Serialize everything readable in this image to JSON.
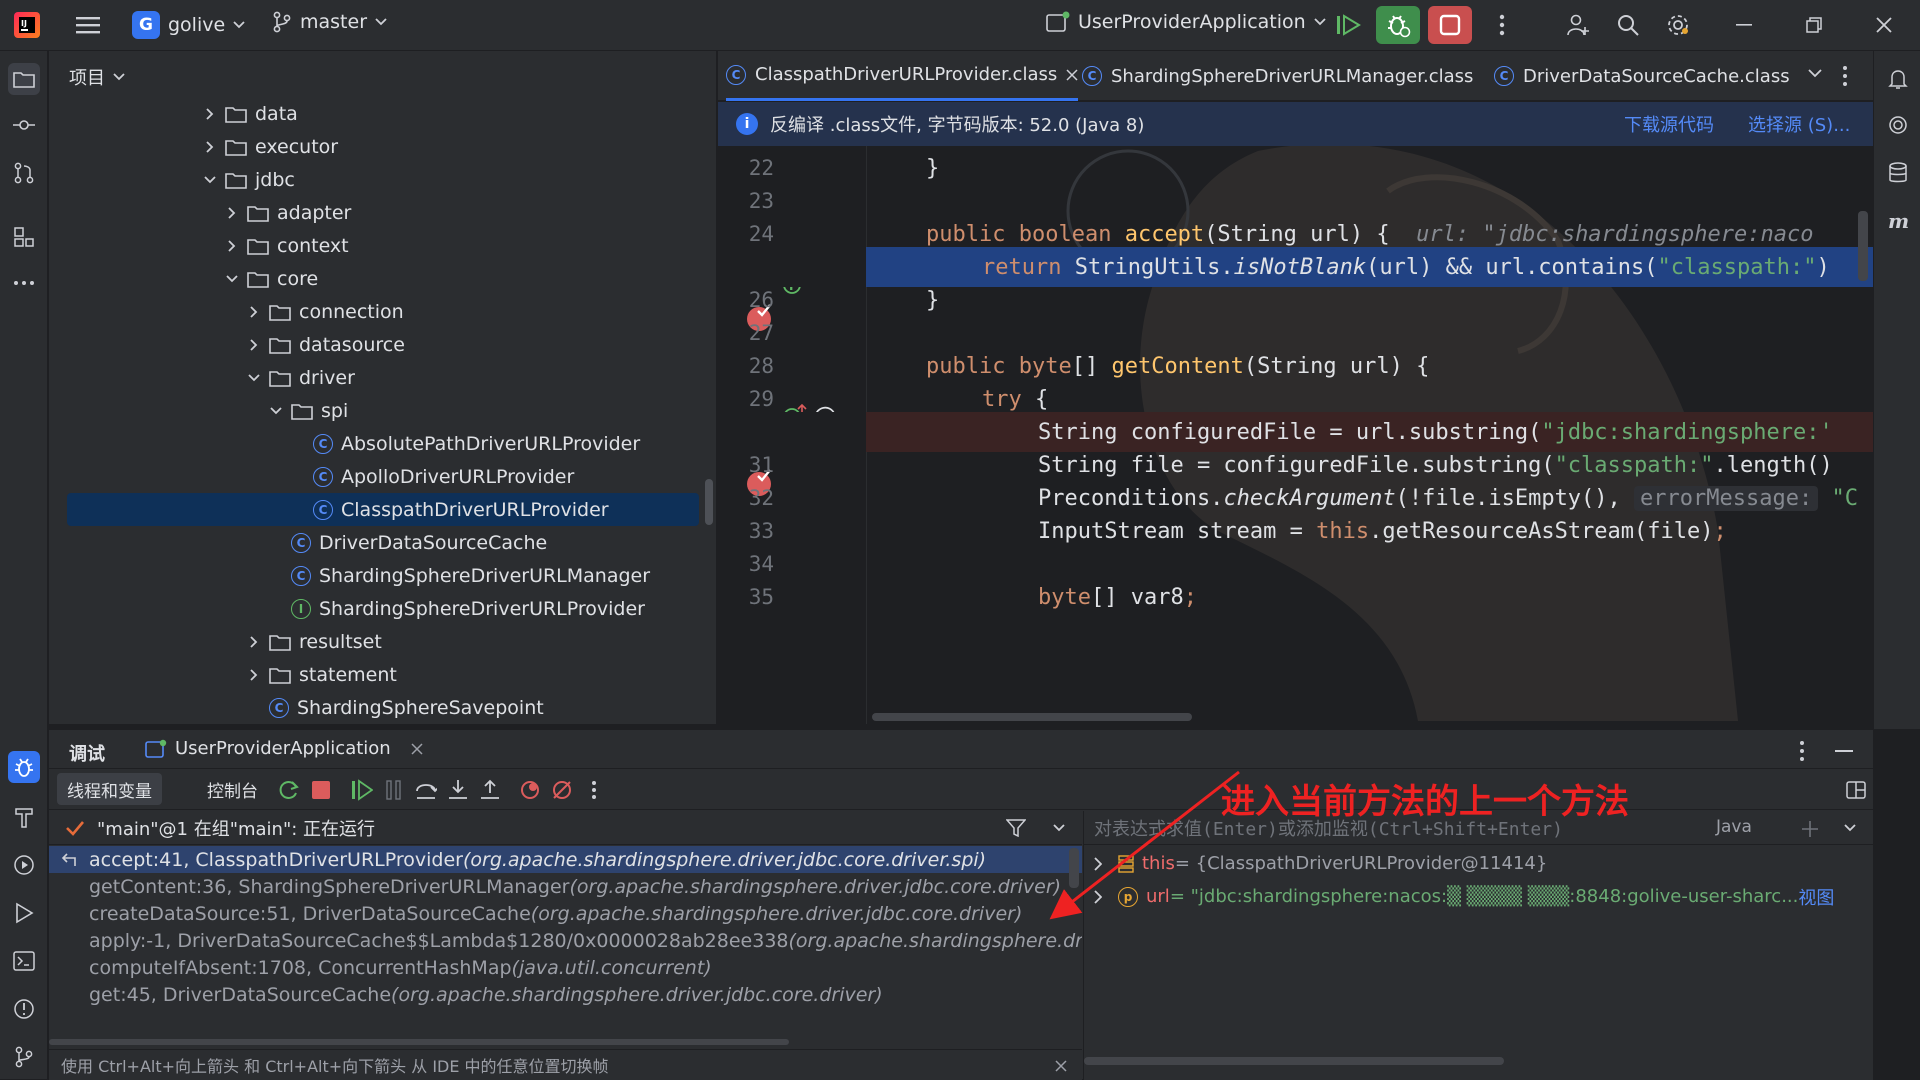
{
  "titlebar": {
    "project_badge": "G",
    "project_name": "golive",
    "branch": "master",
    "run_config": "UserProviderApplication"
  },
  "project_panel": {
    "title": "项目",
    "tree": [
      {
        "label": "data",
        "kind": "folder",
        "open": false,
        "depth": 0
      },
      {
        "label": "executor",
        "kind": "folder",
        "open": false,
        "depth": 0
      },
      {
        "label": "jdbc",
        "kind": "folder",
        "open": true,
        "depth": 0
      },
      {
        "label": "adapter",
        "kind": "folder",
        "open": false,
        "depth": 1
      },
      {
        "label": "context",
        "kind": "folder",
        "open": false,
        "depth": 1
      },
      {
        "label": "core",
        "kind": "folder",
        "open": true,
        "depth": 1
      },
      {
        "label": "connection",
        "kind": "folder",
        "open": false,
        "depth": 2
      },
      {
        "label": "datasource",
        "kind": "folder",
        "open": false,
        "depth": 2
      },
      {
        "label": "driver",
        "kind": "folder",
        "open": true,
        "depth": 2
      },
      {
        "label": "spi",
        "kind": "folder",
        "open": true,
        "depth": 3
      },
      {
        "label": "AbsolutePathDriverURLProvider",
        "kind": "class",
        "depth": 4
      },
      {
        "label": "ApolloDriverURLProvider",
        "kind": "class",
        "depth": 4
      },
      {
        "label": "ClasspathDriverURLProvider",
        "kind": "class",
        "depth": 4,
        "selected": true
      },
      {
        "label": "DriverDataSourceCache",
        "kind": "class",
        "depth": 3
      },
      {
        "label": "ShardingSphereDriverURLManager",
        "kind": "class",
        "depth": 3
      },
      {
        "label": "ShardingSphereDriverURLProvider",
        "kind": "interface",
        "depth": 3
      },
      {
        "label": "resultset",
        "kind": "folder",
        "open": false,
        "depth": 2
      },
      {
        "label": "statement",
        "kind": "folder",
        "open": false,
        "depth": 2
      },
      {
        "label": "ShardingSphereSavepoint",
        "kind": "class",
        "depth": 2
      }
    ]
  },
  "editor": {
    "tabs": [
      {
        "label": "ClasspathDriverURLProvider.class",
        "active": true
      },
      {
        "label": "ShardingSphereDriverURLManager.class",
        "active": false
      },
      {
        "label": "DriverDataSourceCache.class",
        "active": false
      }
    ],
    "infobar": {
      "text": "反编译 .class文件, 字节码版本: 52.0 (Java 8)",
      "download_link": "下载源代码",
      "choose_link": "选择源 (S)..."
    },
    "line_numbers": [
      "22",
      "23",
      "24",
      "",
      "26",
      "27",
      "28",
      "29",
      "",
      "31",
      "32",
      "33",
      "34",
      "35"
    ],
    "code": {
      "l22": "}",
      "l24_kw1": "public",
      "l24_kw2": "boolean",
      "l24_fn": "accept",
      "l24_rest": "(String url) {",
      "l24_hint": "url: \"jdbc:shardingsphere:naco",
      "l25_kw": "return",
      "l25_a": " StringUtils.",
      "l25_fn": "isNotBlank",
      "l25_b": "(url) && url.contains(",
      "l25_str": "\"classpath:\"",
      "l25_c": ")",
      "l26": "}",
      "l28_kw1": "public",
      "l28_kw2": "byte",
      "l28_a": "[] ",
      "l28_fn": "getContent",
      "l28_rest": "(String url) {",
      "l29_kw": "try",
      "l29_rest": " {",
      "l30_a": "String configuredFile = url.substring(",
      "l30_str": "\"jdbc:shardingsphere:'",
      "l31_a": "String file = configuredFile.substring(",
      "l31_str": "\"classpath:\"",
      "l31_b": ".length()",
      "l32_a": "Preconditions.",
      "l32_fn": "checkArgument",
      "l32_b": "(!file.isEmpty(),",
      "l32_hint": "errorMessage:",
      "l32_str": "\"C",
      "l33_a": "InputStream stream = ",
      "l33_kw": "this",
      "l33_b": ".getResourceAsStream(file)",
      "l33_semi": ";",
      "l35_kw": "byte",
      "l35_a": "[] var8",
      "l35_semi": ";"
    }
  },
  "debug": {
    "tab_debug": "调试",
    "tab_session": "UserProviderApplication",
    "subtab_threads": "线程和变量",
    "subtab_console": "控制台",
    "thread_status": "\"main\"@1 在组\"main\": 正在运行",
    "frames": [
      {
        "loc": "accept:41, ClasspathDriverURLProvider ",
        "pkg": "(org.apache.shardingsphere.driver.jdbc.core.driver.spi)",
        "selected": true
      },
      {
        "loc": "getContent:36, ShardingSphereDriverURLManager ",
        "pkg": "(org.apache.shardingsphere.driver.jdbc.core.driver)"
      },
      {
        "loc": "createDataSource:51, DriverDataSourceCache ",
        "pkg": "(org.apache.shardingsphere.driver.jdbc.core.driver)"
      },
      {
        "loc": "apply:-1, DriverDataSourceCache$$Lambda$1280/0x0000028ab28ee338 ",
        "pkg": "(org.apache.shardingsphere.drive"
      },
      {
        "loc": "computeIfAbsent:1708, ConcurrentHashMap ",
        "pkg": "(java.util.concurrent)"
      },
      {
        "loc": "get:45, DriverDataSourceCache ",
        "pkg": "(org.apache.shardingsphere.driver.jdbc.core.driver)"
      }
    ],
    "hint_bar": "使用 Ctrl+Alt+向上箭头 和 Ctrl+Alt+向下箭头 从 IDE 中的任意位置切换帧",
    "eval_placeholder": "对表达式求值(Enter)或添加监视(Ctrl+Shift+Enter)",
    "eval_lang": "Java",
    "vars": [
      {
        "name": "this",
        "value": " = {ClasspathDriverURLProvider@11414}"
      },
      {
        "name": "url",
        "value": " = \"jdbc:shardingsphere:nacos:▒ ▒▒▒▒ ▒▒▒:8848:golive-user-sharc...",
        "link": "视图"
      }
    ],
    "annotation": "进入当前方法的上一个方法"
  },
  "colors": {
    "accent": "#3574f0",
    "breakpoint": "#db5c5c",
    "annotation_red": "#ee2222",
    "selection": "#2e436e"
  }
}
